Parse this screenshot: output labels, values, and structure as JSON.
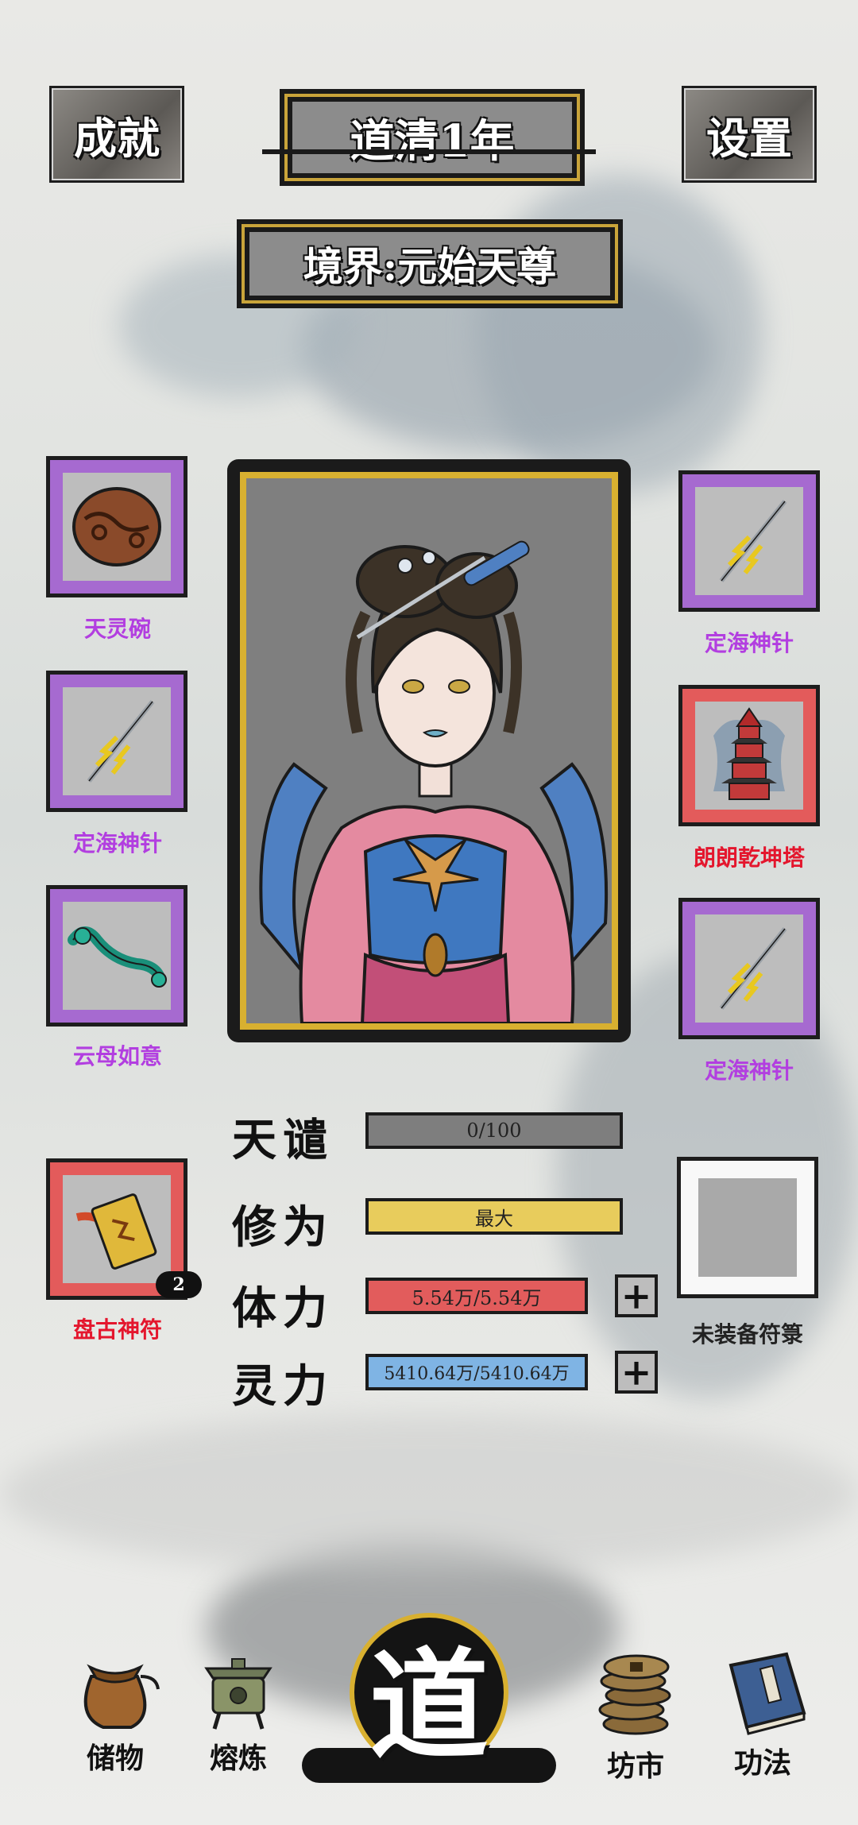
{
  "header": {
    "achievements_label": "成就",
    "year_label": "道清1年",
    "settings_label": "设置",
    "realm_label": "境界:元始天尊"
  },
  "equipment": {
    "left": [
      {
        "name": "天灵碗",
        "rarity": "purple"
      },
      {
        "name": "定海神针",
        "rarity": "purple"
      },
      {
        "name": "云母如意",
        "rarity": "purple"
      },
      {
        "name": "盘古神符",
        "rarity": "red",
        "count": "2"
      }
    ],
    "right": [
      {
        "name": "定海神针",
        "rarity": "purple"
      },
      {
        "name": "朗朗乾坤塔",
        "rarity": "red"
      },
      {
        "name": "定海神针",
        "rarity": "purple"
      },
      {
        "name": "未装备符箓",
        "rarity": "none"
      }
    ]
  },
  "stats": {
    "tianqian": {
      "label": "天谴",
      "value": "0/100",
      "fraction": 0
    },
    "xiuwei": {
      "label": "修为",
      "value": "最大",
      "fraction": 1
    },
    "tili": {
      "label": "体力",
      "value": "5.54万/5.54万",
      "fraction": 1
    },
    "lingli": {
      "label": "灵力",
      "value": "5410.64万/5410.64万",
      "fraction": 1
    },
    "plus_symbol": "+"
  },
  "nav": {
    "storage": "储物",
    "smelting": "熔炼",
    "center": "道",
    "market": "坊市",
    "techniques": "功法"
  },
  "colors": {
    "purple_frame": "#a66ad0",
    "red_frame": "#e35b5b",
    "tianqian_bar": "#7e7e7e",
    "xiuwei_bar": "#e8cc5c",
    "tili_bar": "#e25c5c",
    "lingli_bar": "#7fb4e4",
    "gold": "#d8b030"
  }
}
